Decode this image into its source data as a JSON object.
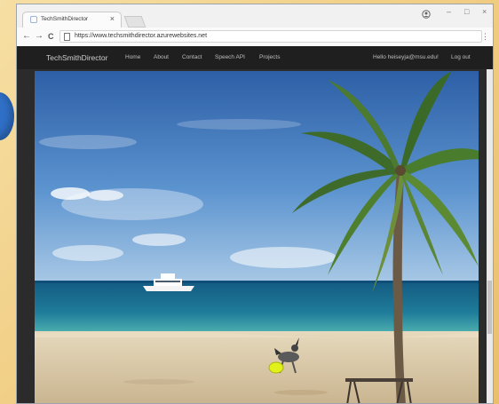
{
  "browser": {
    "tab_title": "TechSmithDirector",
    "tab_close": "×",
    "back": "←",
    "forward": "→",
    "reload": "C",
    "url": "https://www.techsmithdirector.azurewebsites.net",
    "account_icon": "user-circle-icon",
    "minimize": "–",
    "maximize": "□",
    "close": "×",
    "menu": "⋮"
  },
  "site": {
    "brand": "TechSmithDirector",
    "nav": [
      "Home",
      "About",
      "Contact",
      "Speech API",
      "Projects"
    ],
    "greeting": "Hello heiseyja@msu.edu!",
    "logout": "Log out"
  },
  "hero": {
    "description": "Beach photo with palm tree, yacht on the water, and a dog with a yellow frisbee"
  },
  "colors": {
    "navbar": "#1f1f1f",
    "sky_top": "#2d5fa6",
    "sea": "#1f7c9a",
    "sand": "#d8c7a6"
  }
}
